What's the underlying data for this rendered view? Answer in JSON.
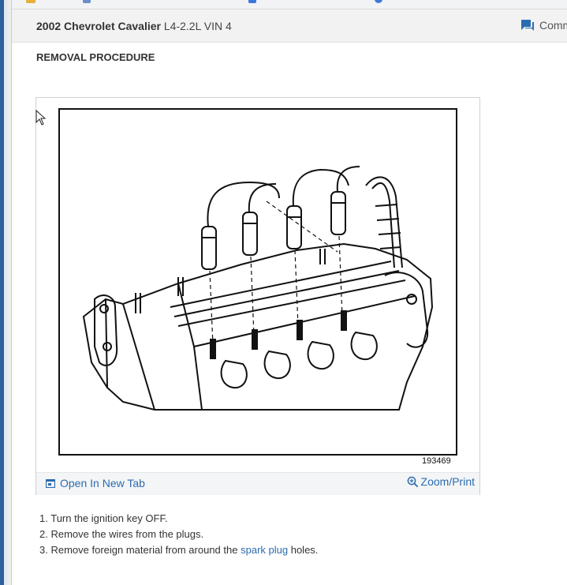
{
  "header": {
    "title_bold": "2002 Chevrolet Cavalier",
    "title_rest": "L4-2.2L VIN 4",
    "comments_label": "Comm"
  },
  "section_title": "REMOVAL PROCEDURE",
  "figure": {
    "number": "193469",
    "open_label": "Open In New Tab",
    "zoom_label": "Zoom/Print"
  },
  "steps": [
    {
      "num": "1.",
      "text": "Turn the ignition key OFF."
    },
    {
      "num": "2.",
      "text": "Remove the wires from the plugs."
    },
    {
      "num": "3.",
      "text_before": "Remove foreign material from around the",
      "link": "spark plug",
      "text_after": "holes."
    }
  ],
  "colors": {
    "link": "#2b6cb0",
    "header_bg": "#f2f2f2",
    "window_accent": "#2b5f9e"
  }
}
